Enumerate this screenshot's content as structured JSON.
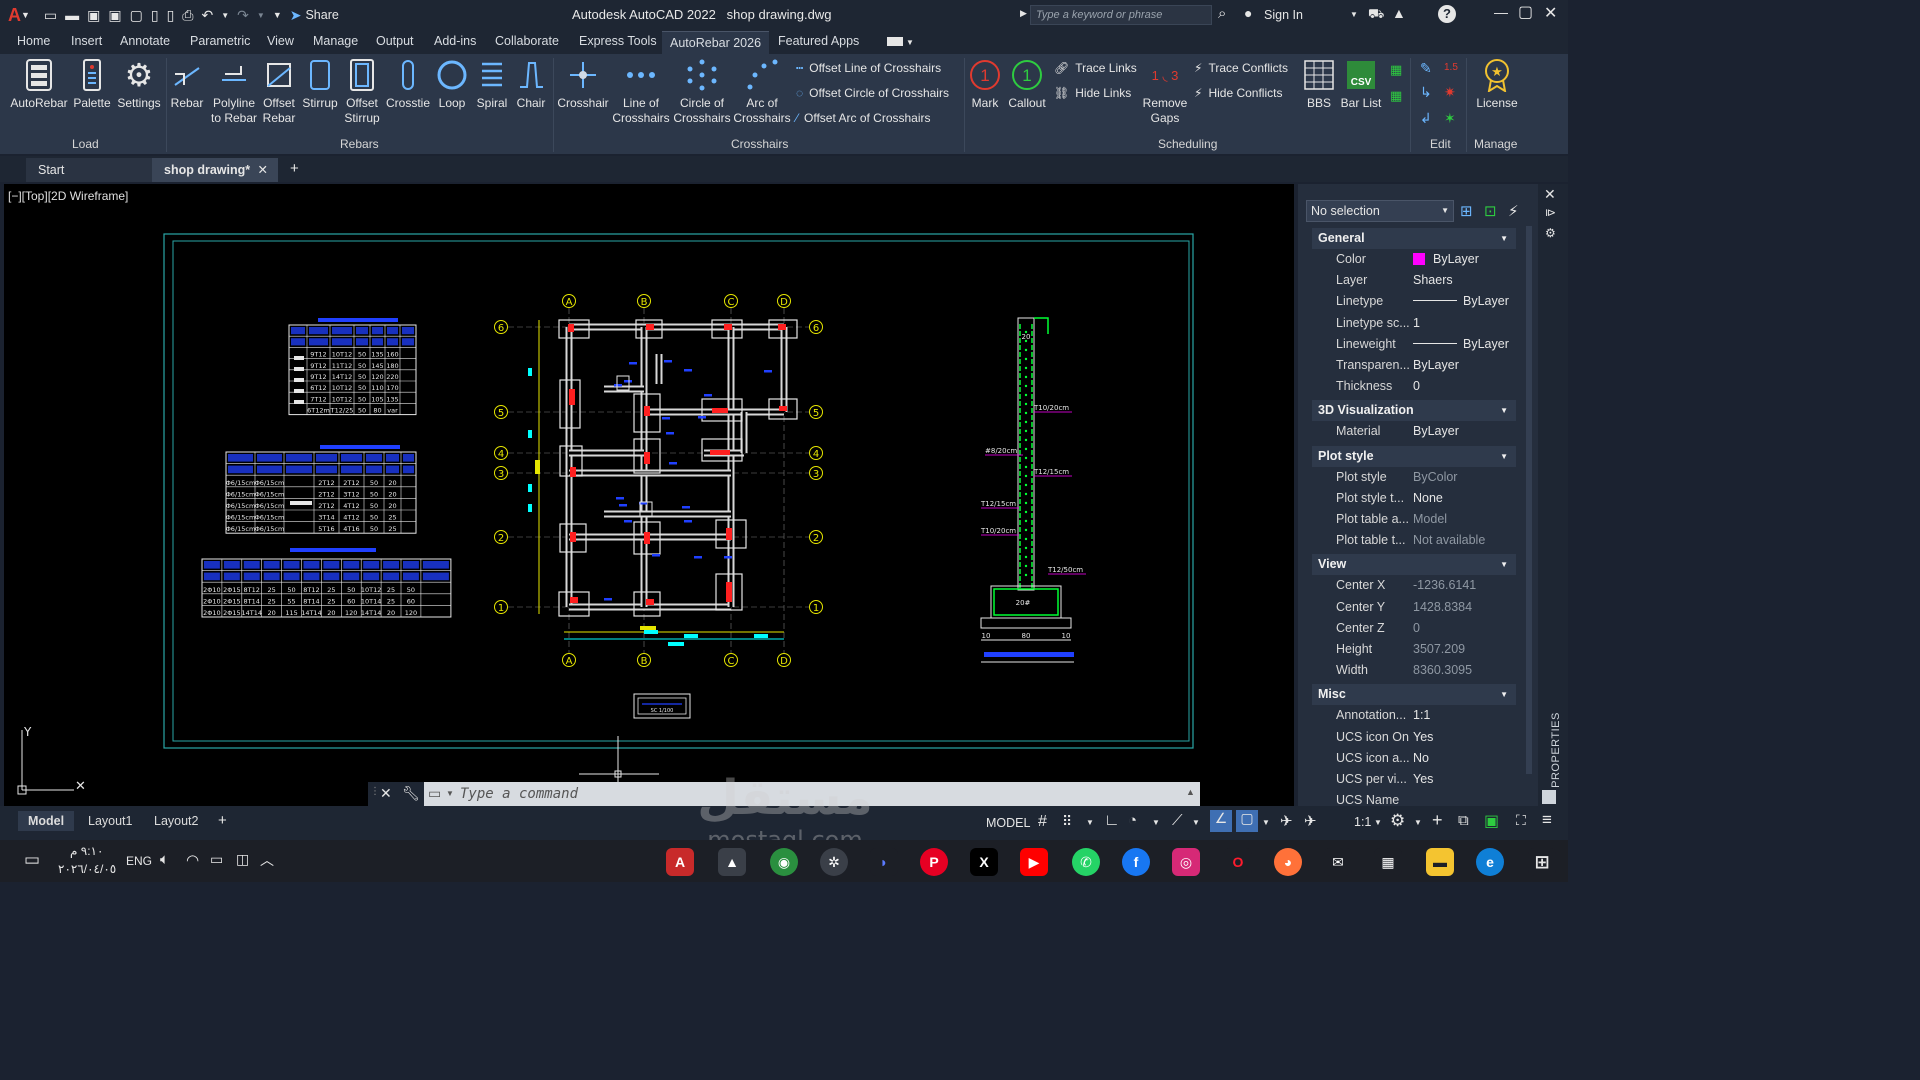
{
  "titlebar": {
    "app_title": "Autodesk AutoCAD 2022",
    "file_name": "shop drawing.dwg",
    "share_label": "Share",
    "search_placeholder": "Type a keyword or phrase",
    "sign_in_label": "Sign In"
  },
  "menu": {
    "tabs": [
      "Home",
      "Insert",
      "Annotate",
      "Parametric",
      "View",
      "Manage",
      "Output",
      "Add-ins",
      "Collaborate",
      "Express Tools",
      "AutoRebar 2026",
      "Featured Apps"
    ],
    "active_index": 10
  },
  "ribbon": {
    "load": {
      "label": "Load",
      "buttons": [
        "AutoRebar",
        "Palette",
        "Settings"
      ]
    },
    "rebars": {
      "label": "Rebars",
      "buttons": [
        "Rebar",
        "Polyline",
        "to Rebar",
        "Offset",
        "Rebar",
        "Stirrup",
        "Offset",
        "Stirrup",
        "Crosstie",
        "Loop",
        "Spiral",
        "Chair"
      ]
    },
    "crosshairs": {
      "label": "Crosshairs",
      "buttons": [
        "Crosshair",
        "Line of",
        "Crosshairs",
        "Circle of",
        "Crosshairs",
        "Arc of",
        "Crosshairs"
      ],
      "small": [
        "Offset Line of Crosshairs",
        "Offset Circle of Crosshairs",
        "Offset Arc of Crosshairs"
      ]
    },
    "scheduling": {
      "label": "Scheduling",
      "buttons": [
        "Mark",
        "Callout",
        "Remove",
        "Gaps",
        "BBS",
        "Bar List"
      ],
      "small": [
        "Trace Links",
        "Hide Links",
        "Trace Conflicts",
        "Hide Conflicts"
      ]
    },
    "edit": {
      "label": "Edit"
    },
    "manage": {
      "label": "Manage",
      "buttons": [
        "License"
      ]
    }
  },
  "doc_tabs": {
    "start": "Start",
    "active": "shop drawing*"
  },
  "viewport": {
    "label": "[−][Top][2D Wireframe]"
  },
  "drawing": {
    "grid_letters": [
      "A",
      "B",
      "C",
      "D"
    ],
    "grid_numbers": [
      "6",
      "5",
      "4",
      "3",
      "2",
      "1"
    ],
    "section_labels": [
      "T10/20cm",
      "T12/15cm",
      "#8/20cm",
      "T12/15cm",
      "T10/20cm",
      "T12/50cm",
      "20",
      "20#",
      "10",
      "80",
      "10"
    ],
    "table1_rows": [
      [
        "9T12",
        "10T12",
        "50",
        "135",
        "160"
      ],
      [
        "9T12",
        "11T12",
        "50",
        "145",
        "180"
      ],
      [
        "9T12",
        "14T12",
        "50",
        "120",
        "220"
      ],
      [
        "6T12",
        "10T12",
        "50",
        "110",
        "170"
      ],
      [
        "7T12",
        "10T12",
        "50",
        "105",
        "135"
      ],
      [
        "6T12m",
        "T12/25",
        "50",
        "80",
        "var"
      ]
    ],
    "table2_rows": [
      [
        "Φ6/15cm",
        "Φ6/15cm",
        "",
        "2T12",
        "2T12",
        "50",
        "20"
      ],
      [
        "Φ6/15cm",
        "Φ6/15cm",
        "",
        "2T12",
        "3T12",
        "50",
        "20"
      ],
      [
        "Φ6/15cm",
        "Φ6/15cm",
        "",
        "2T12",
        "4T12",
        "50",
        "20"
      ],
      [
        "Φ6/15cm",
        "Φ6/15cm",
        "",
        "3T14",
        "4T12",
        "50",
        "25"
      ],
      [
        "Φ6/15cm",
        "Φ6/15cm",
        "",
        "5T16",
        "4T16",
        "50",
        "25"
      ]
    ],
    "table3_rows": [
      [
        "2Φ10",
        "2Φ15",
        "8T12",
        "25",
        "50",
        "8T12",
        "25",
        "50",
        "10T12",
        "25",
        "50"
      ],
      [
        "2Φ10",
        "2Φ15",
        "8T14",
        "25",
        "55",
        "8T14",
        "25",
        "60",
        "10T14",
        "25",
        "60"
      ],
      [
        "2Φ10",
        "2Φ15",
        "14T14",
        "20",
        "115",
        "14T14",
        "20",
        "120",
        "14T14",
        "20",
        "120"
      ]
    ],
    "scale_label": "SC 1/100"
  },
  "properties": {
    "selection": "No selection",
    "side_title": "PROPERTIES",
    "sections": [
      {
        "title": "General",
        "rows": [
          [
            "Color",
            "ByLayer"
          ],
          [
            "Layer",
            "Shaers"
          ],
          [
            "Linetype",
            "ByLayer"
          ],
          [
            "Linetype sc...",
            "1"
          ],
          [
            "Lineweight",
            "ByLayer"
          ],
          [
            "Transparen...",
            "ByLayer"
          ],
          [
            "Thickness",
            "0"
          ]
        ]
      },
      {
        "title": "3D Visualization",
        "rows": [
          [
            "Material",
            "ByLayer"
          ]
        ]
      },
      {
        "title": "Plot style",
        "rows": [
          [
            "Plot style",
            "ByColor"
          ],
          [
            "Plot style t...",
            "None"
          ],
          [
            "Plot table a...",
            "Model"
          ],
          [
            "Plot table t...",
            "Not available"
          ]
        ]
      },
      {
        "title": "View",
        "rows": [
          [
            "Center X",
            "-1236.6141"
          ],
          [
            "Center Y",
            "1428.8384"
          ],
          [
            "Center Z",
            "0"
          ],
          [
            "Height",
            "3507.209"
          ],
          [
            "Width",
            "8360.3095"
          ]
        ]
      },
      {
        "title": "Misc",
        "rows": [
          [
            "Annotation...",
            "1:1"
          ],
          [
            "UCS icon On",
            "Yes"
          ],
          [
            "UCS icon a...",
            "No"
          ],
          [
            "UCS per vi...",
            "Yes"
          ],
          [
            "UCS Name",
            ""
          ]
        ]
      }
    ],
    "color_swatch": "#ff00ff"
  },
  "command": {
    "placeholder": "Type a command"
  },
  "status": {
    "layout_tabs": [
      "Model",
      "Layout1",
      "Layout2"
    ],
    "model_label": "MODEL",
    "scale": "1:1"
  },
  "taskbar": {
    "time": "٩:١٠ م",
    "date": "٢٠٢٦/٠٤/٠٥",
    "lang": "ENG"
  },
  "watermark": {
    "arabic": "مستقل",
    "latin": "mostaql.com"
  },
  "colors": {
    "accent": "#e03a2f",
    "cyan": "#00ffff",
    "green": "#00ff33",
    "red": "#ff2020",
    "blue": "#2040ff",
    "magenta": "#ff00ff"
  }
}
